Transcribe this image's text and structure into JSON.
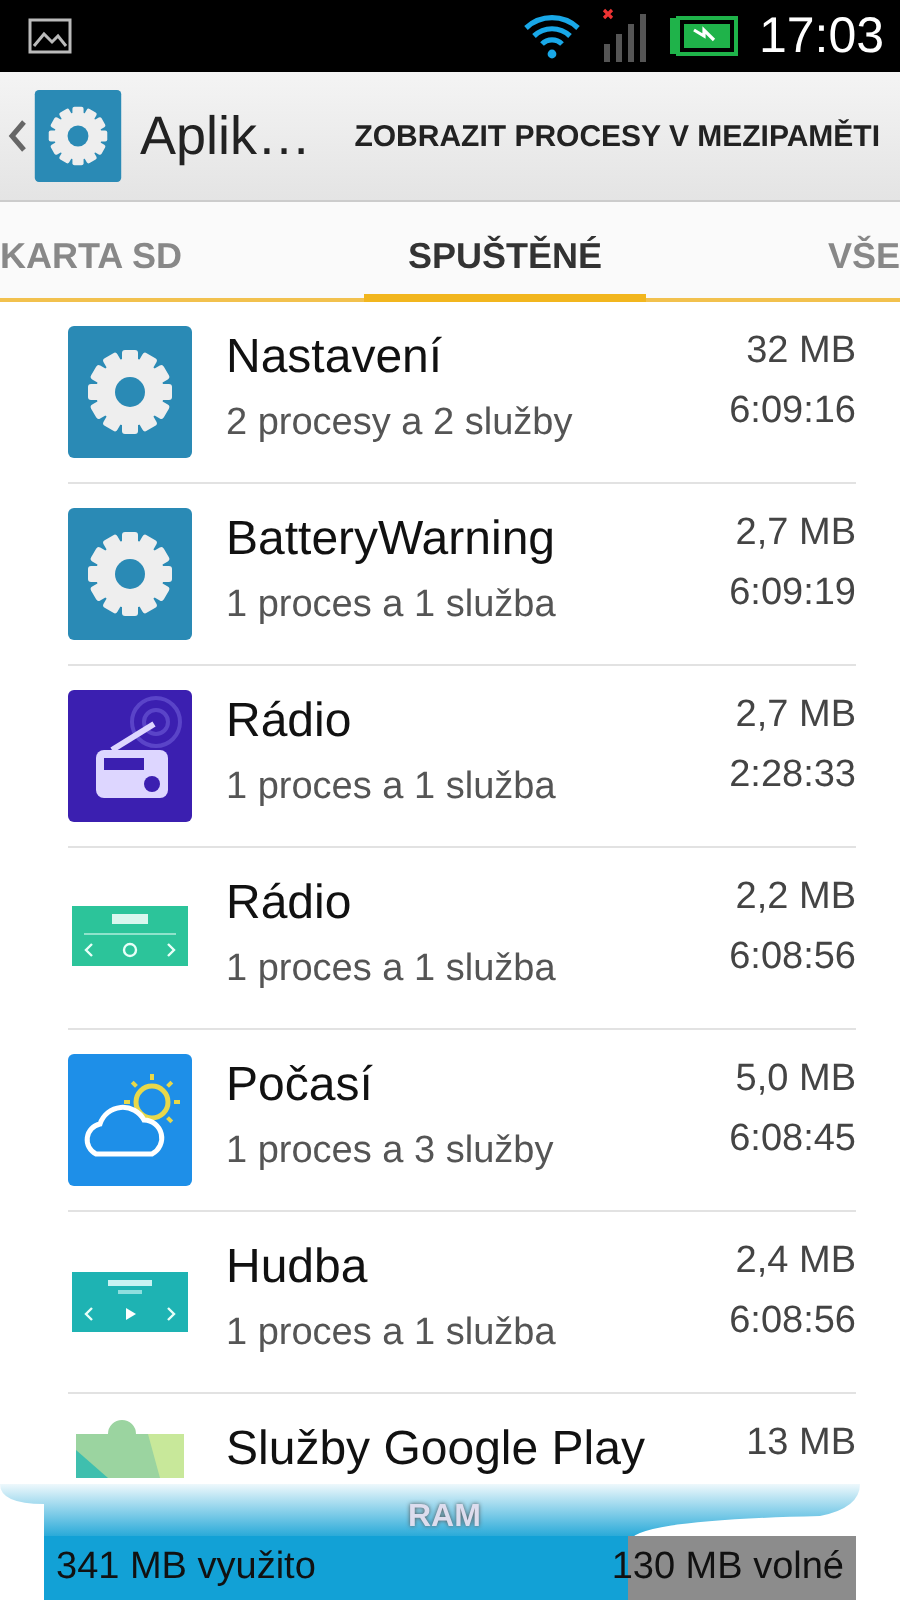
{
  "status_bar": {
    "time": "17:03"
  },
  "app_bar": {
    "title": "Aplik…",
    "action": "ZOBRAZIT PROCESY V MEZIPAMĚTI"
  },
  "tabs": [
    {
      "label": "KARTA SD",
      "selected": false
    },
    {
      "label": "SPUŠTĚNÉ",
      "selected": true
    },
    {
      "label": "VŠE",
      "selected": false
    }
  ],
  "processes": [
    {
      "kind": "gear",
      "name": "Nastavení",
      "detail": "2 procesy a 2 služby",
      "size": "32 MB",
      "time": "6:09:16"
    },
    {
      "kind": "gear",
      "name": "BatteryWarning",
      "detail": "1 proces a 1 služba",
      "size": "2,7 MB",
      "time": "6:09:19"
    },
    {
      "kind": "radio",
      "name": "Rádio",
      "detail": "1 proces a 1 služba",
      "size": "2,7 MB",
      "time": "2:28:33"
    },
    {
      "kind": "radio-widget",
      "name": "Rádio",
      "detail": "1 proces a 1 služba",
      "size": "2,2 MB",
      "time": "6:08:56"
    },
    {
      "kind": "weather",
      "name": "Počasí",
      "detail": "1 proces a 3 služby",
      "size": "5,0 MB",
      "time": "6:08:45"
    },
    {
      "kind": "music-widget",
      "name": "Hudba",
      "detail": "1 proces a 1 služba",
      "size": "2,4 MB",
      "time": "6:08:56"
    },
    {
      "kind": "puzzle",
      "name": "Služby Google Play",
      "size": "13 MB"
    }
  ],
  "ram": {
    "label": "RAM",
    "used": "341 MB využito",
    "free": "130 MB volné",
    "level": 0.72
  }
}
